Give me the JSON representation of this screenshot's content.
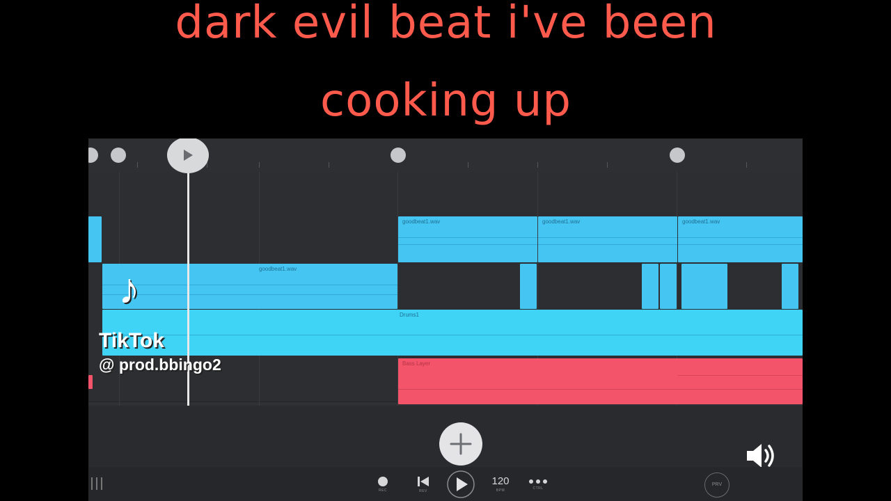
{
  "caption": {
    "line1": "dark evil beat i've been",
    "line2": "cooking up"
  },
  "watermark": {
    "brand": "TikTok",
    "handle": "@ prod.bbingo2"
  },
  "transport": {
    "tempo": "120",
    "record_caption": "REC",
    "rewind_caption": "REV",
    "bpm_caption": "BPM",
    "more_caption": "CTRL",
    "preview_label": "PRV"
  },
  "clips": {
    "guitar_a": "goodbeat1.wav",
    "guitar_b": "goodbeat1.wav",
    "guitar_c": "goodbeat1.wav",
    "melody": "goodbeat1.wav",
    "drums": "Drums1",
    "bass": "Bass Layer"
  },
  "colors": {
    "caption": "#ff5a4c",
    "clip_blue": "#45c6f2",
    "clip_cyan": "#3fd3f5",
    "clip_pink": "#f4546a",
    "background": "#000000"
  },
  "icons": {
    "play": "play-triangle",
    "add": "plus",
    "volume": "speaker",
    "rewind": "skip-back",
    "more": "ellipsis",
    "menu": "hamburger",
    "brand": "tiktok-note"
  }
}
